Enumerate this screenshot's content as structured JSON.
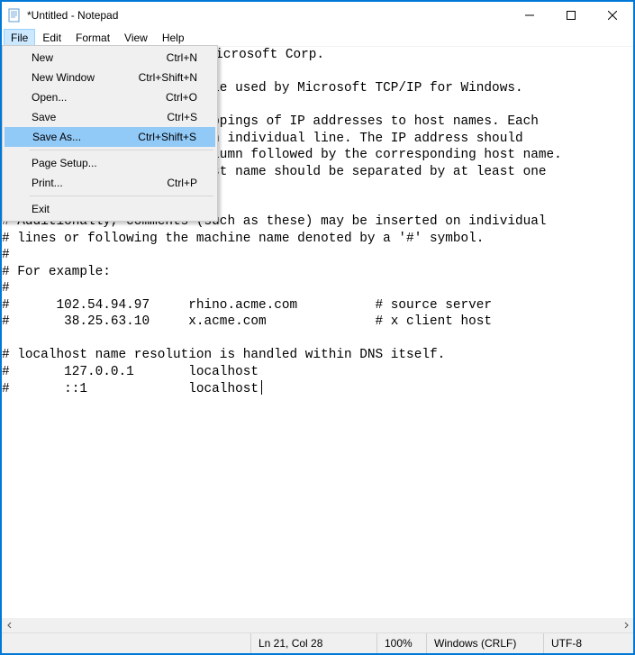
{
  "window": {
    "title": "*Untitled - Notepad"
  },
  "menubar": {
    "items": [
      "File",
      "Edit",
      "Format",
      "View",
      "Help"
    ]
  },
  "file_menu": {
    "new": {
      "label": "New",
      "shortcut": "Ctrl+N"
    },
    "new_window": {
      "label": "New Window",
      "shortcut": "Ctrl+Shift+N"
    },
    "open": {
      "label": "Open...",
      "shortcut": "Ctrl+O"
    },
    "save": {
      "label": "Save",
      "shortcut": "Ctrl+S"
    },
    "save_as": {
      "label": "Save As...",
      "shortcut": "Ctrl+Shift+S"
    },
    "page_setup": {
      "label": "Page Setup...",
      "shortcut": ""
    },
    "print": {
      "label": "Print...",
      "shortcut": "Ctrl+P"
    },
    "exit": {
      "label": "Exit",
      "shortcut": ""
    }
  },
  "editor": {
    "content": "# Copyright (c) 1993-2009 Microsoft Corp.\n#\n# This is a sample HOSTS file used by Microsoft TCP/IP for Windows.\n#\n# This file contains the mappings of IP addresses to host names. Each\n# entry should be kept on an individual line. The IP address should\n# be placed in the first column followed by the corresponding host name.\n# The IP address and the host name should be separated by at least one\n# space.\n#\n# Additionally, comments (such as these) may be inserted on individual\n# lines or following the machine name denoted by a '#' symbol.\n#\n# For example:\n#\n#      102.54.94.97     rhino.acme.com          # source server\n#       38.25.63.10     x.acme.com              # x client host\n\n# localhost name resolution is handled within DNS itself.\n#       127.0.0.1       localhost\n#       ::1             localhost"
  },
  "statusbar": {
    "position": "Ln 21, Col 28",
    "zoom": "100%",
    "line_ending": "Windows (CRLF)",
    "encoding": "UTF-8"
  }
}
